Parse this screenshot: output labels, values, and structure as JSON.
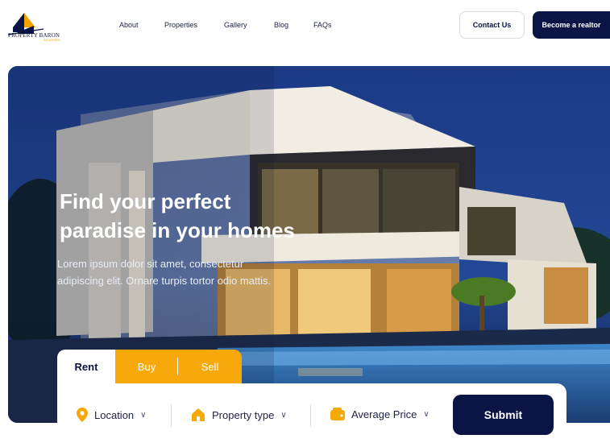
{
  "brand": {
    "name": "PROPERTY BARON",
    "tagline": "ADVISORS"
  },
  "nav": {
    "items": [
      "About",
      "Properties",
      "Gallery",
      "Blog",
      "FAQs"
    ],
    "contact_label": "Contact Us",
    "realtor_label": "Become a realtor"
  },
  "hero": {
    "title_line1": "Find your perfect",
    "title_line2": "paradise in your homes",
    "desc_line1": "Lorem ipsum dolor sit amet, consectetur",
    "desc_line2": "adipiscing elit. Ornare turpis tortor odio mattis."
  },
  "tabs": {
    "rent": "Rent",
    "buy": "Buy",
    "sell": "Sell",
    "active": "Rent"
  },
  "search": {
    "location": "Location",
    "property_type": "Property type",
    "average_price": "Average Price",
    "submit": "Submit"
  },
  "colors": {
    "navy": "#0b1545",
    "accent": "#f7a90b",
    "sky": "#1e3c86"
  },
  "icons": [
    "location-pin-icon",
    "home-icon",
    "wallet-icon",
    "chevron-down-icon"
  ]
}
